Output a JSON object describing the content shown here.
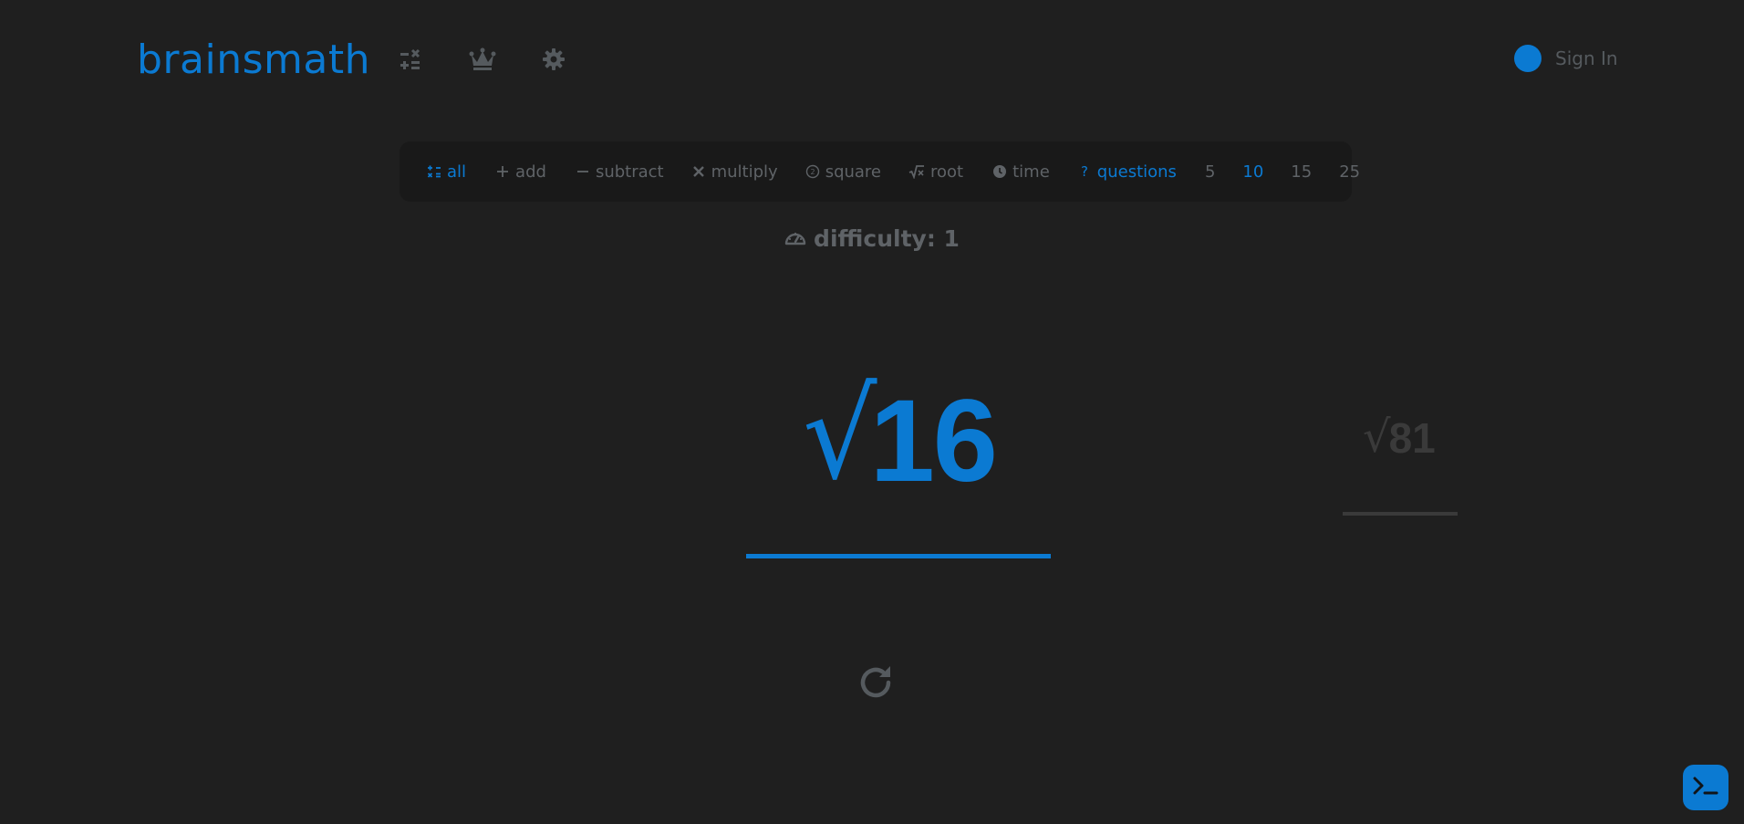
{
  "brand": {
    "name": "brainsmath",
    "accent_color": "#0b7ad2"
  },
  "header": {
    "nav_icons": [
      "calculator-icon",
      "crown-icon",
      "gear-icon"
    ],
    "sign_in_label": "Sign In"
  },
  "toolbar": {
    "operations": [
      {
        "label": "all",
        "icon": "calculator-icon",
        "active": true
      },
      {
        "label": "add",
        "icon": "plus-icon",
        "active": false
      },
      {
        "label": "subtract",
        "icon": "minus-icon",
        "active": false
      },
      {
        "label": "multiply",
        "icon": "times-icon",
        "active": false
      },
      {
        "label": "square",
        "icon": "square-icon",
        "active": false
      },
      {
        "label": "root",
        "icon": "root-icon",
        "active": false
      }
    ],
    "modes": [
      {
        "label": "time",
        "icon": "clock-icon",
        "active": false
      },
      {
        "label": "questions",
        "icon": "question-icon",
        "active": true
      }
    ],
    "counts": [
      {
        "label": "5",
        "active": false
      },
      {
        "label": "10",
        "active": true
      },
      {
        "label": "15",
        "active": false
      },
      {
        "label": "25",
        "active": false
      }
    ]
  },
  "difficulty": {
    "label": "difficulty: 1",
    "icon": "gauge-icon"
  },
  "problem": {
    "symbol": "√",
    "value": "16"
  },
  "next_problem": {
    "symbol": "√",
    "value": "81"
  },
  "controls": {
    "restart_icon": "restart-icon",
    "terminal_icon": "terminal-icon"
  }
}
